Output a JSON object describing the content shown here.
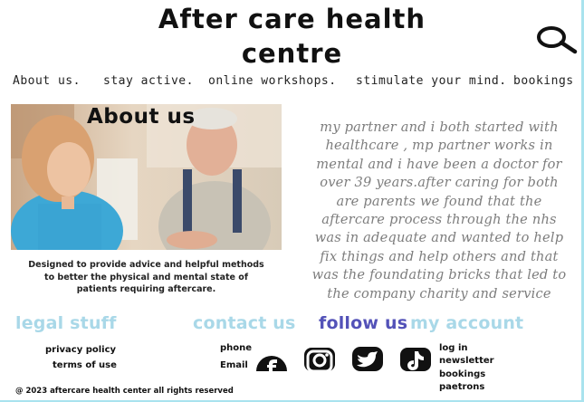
{
  "header": {
    "title_line1": "After care health",
    "title_line2": "centre"
  },
  "nav": {
    "about": "About us.",
    "active": "stay active.",
    "workshops": "online workshops.",
    "mind": "stimulate your mind.",
    "bookings": "bookings"
  },
  "hero": {
    "title": "About us",
    "caption_line1": "Designed to provide advice and helpful methods",
    "caption_line2": "to better the physical and mental state of",
    "caption_line3": "patients requiring aftercare."
  },
  "about_text": [
    "my partner and i both started with",
    "healthcare , mp partner works in",
    "mental and i have been a doctor for",
    "over 39 years.after caring for both",
    "are parents we found that the",
    "aftercare process through the nhs",
    "was in adequate and wanted to help",
    "fix things and help others and that",
    "was the foundating bricks that led to",
    "the company charity and service"
  ],
  "footer": {
    "legal": {
      "heading": "legal stuff",
      "privacy": "privacy policy",
      "terms": "terms of use"
    },
    "contact": {
      "heading": "contact us",
      "phone": "phone",
      "email": "Email"
    },
    "follow": {
      "heading": "follow us"
    },
    "account": {
      "heading": "my account",
      "login": "log in",
      "newsletter": "newsletter",
      "bookings": "bookings",
      "patrons": "paetrons"
    },
    "copyright": "@ 2023 aftercare health center all rights reserved"
  },
  "colors": {
    "light_blue": "#a9d8e8",
    "follow_purple": "#5352b8",
    "about_text_gray": "#7d7d7d"
  },
  "icons": [
    "search-icon",
    "facebook-icon",
    "instagram-icon",
    "twitter-icon",
    "tiktok-icon"
  ]
}
